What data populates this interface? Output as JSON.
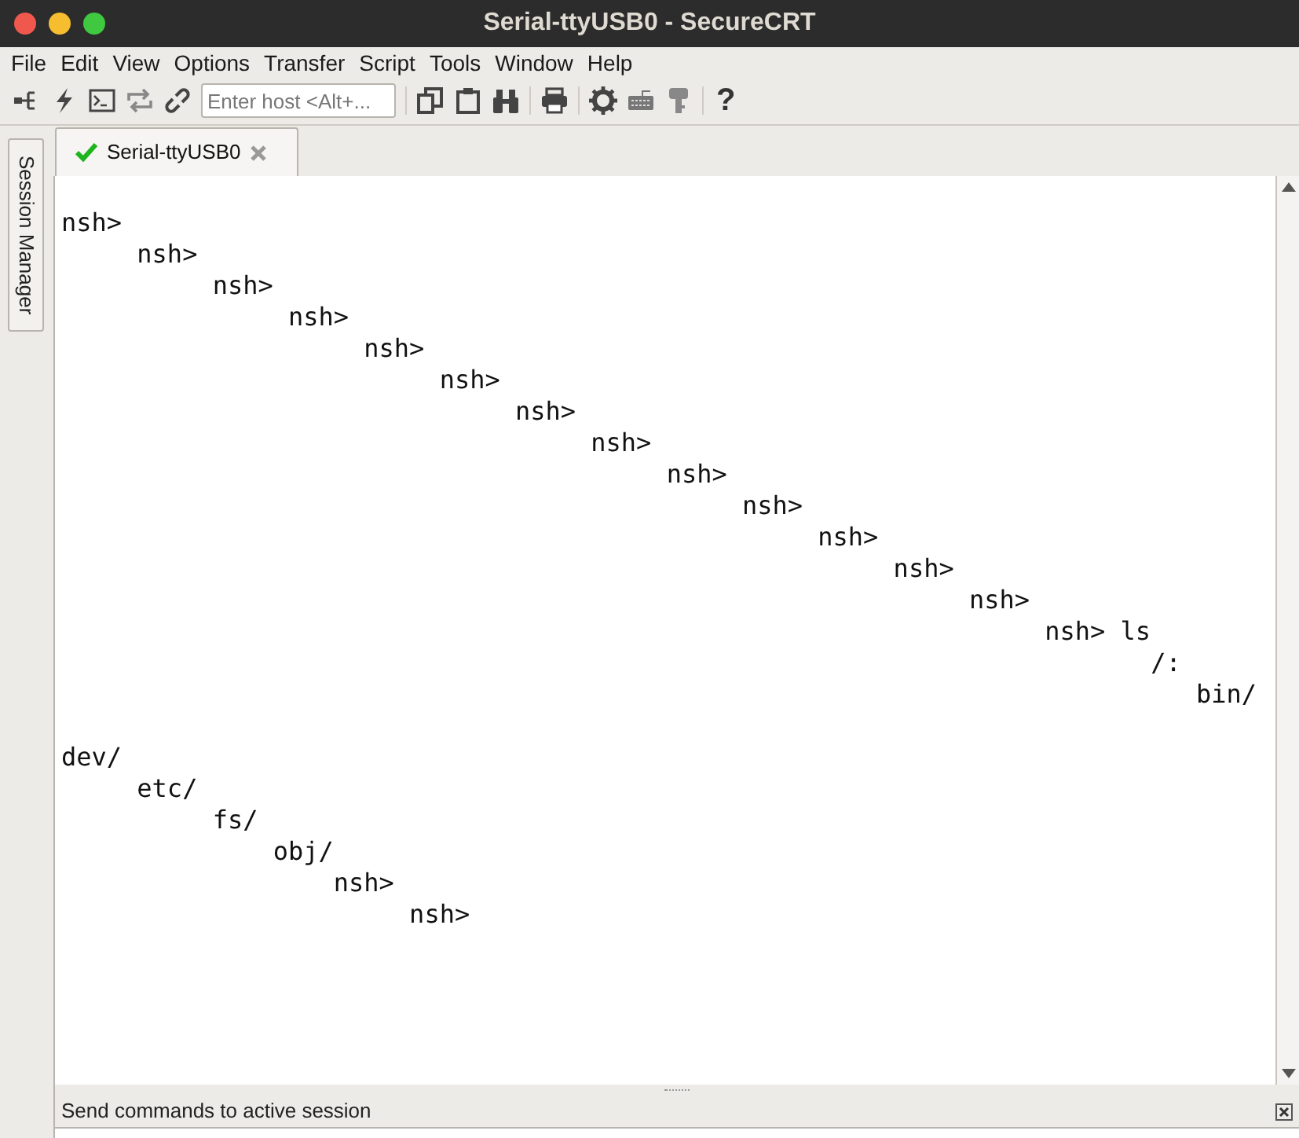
{
  "window": {
    "title": "Serial-ttyUSB0 - SecureCRT"
  },
  "menu": [
    "File",
    "Edit",
    "View",
    "Options",
    "Transfer",
    "Script",
    "Tools",
    "Window",
    "Help"
  ],
  "toolbar": {
    "host_field": {
      "placeholder": "Enter host <Alt+..."
    },
    "help_label": "?"
  },
  "side_tabs": [
    {
      "label": "Session Manager",
      "selected": false
    }
  ],
  "tabs": [
    {
      "label": "Serial-ttyUSB0",
      "selected": true,
      "connected": true
    }
  ],
  "terminal": {
    "output": "nsh>\n     nsh>\n          nsh>\n               nsh>\n                    nsh>\n                         nsh>\n                              nsh>\n                                   nsh>\n                                        nsh>\n                                             nsh>\n                                                  nsh>\n                                                       nsh>\n                                                            nsh>\n                                                                 nsh> ls\n                                                                        /:\n                                                                           bin/\n\ndev/\n     etc/\n          fs/\n              obj/\n                  nsh>\n                       nsh>"
  },
  "command_window": {
    "title": "Send commands to active session"
  }
}
